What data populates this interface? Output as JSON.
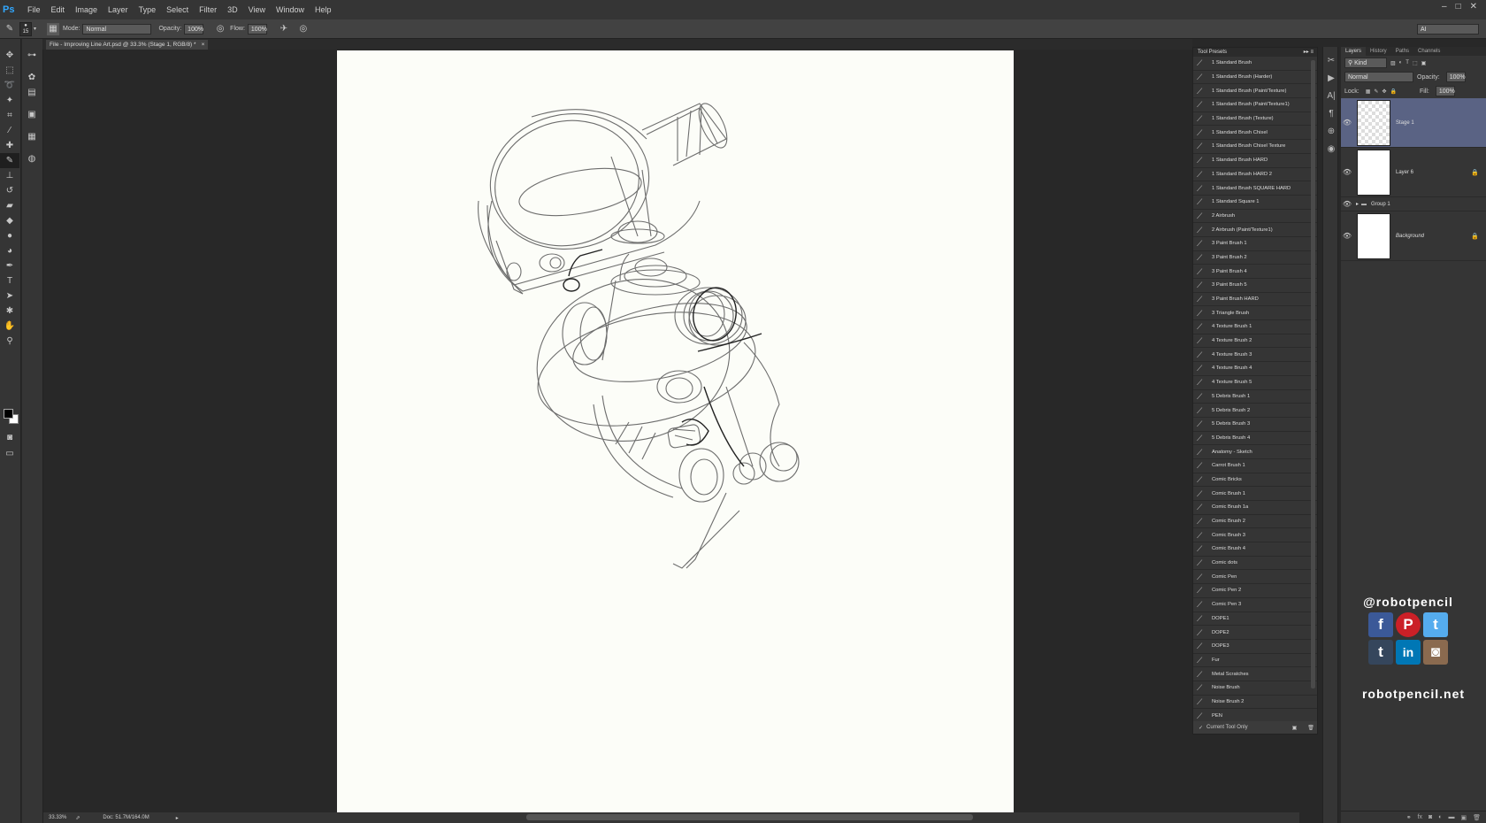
{
  "app": {
    "logo": "Ps",
    "menu": [
      "File",
      "Edit",
      "Image",
      "Layer",
      "Type",
      "Select",
      "Filter",
      "3D",
      "View",
      "Window",
      "Help"
    ],
    "window_controls": [
      "–",
      "□",
      "✕"
    ]
  },
  "options_bar": {
    "brush_size": "15",
    "mode_label": "Mode:",
    "mode_value": "Normal",
    "opacity_label": "Opacity:",
    "opacity_value": "100%",
    "flow_label": "Flow:",
    "flow_value": "100%",
    "workspace_value": "AI"
  },
  "document": {
    "tab_title": "File - Improving Line Art.psd @ 33.3% (Stage 1, RGB/8) *",
    "tab_close": "×"
  },
  "status": {
    "zoom": "33.33%",
    "doc_size": "Doc: 51.7M/164.0M"
  },
  "tool_presets": {
    "title": "Tool Presets",
    "items": [
      "1 Standard Brush",
      "1 Standard Brush (Harder)",
      "1 Standard Brush (Paint/Texture)",
      "1 Standard Brush (Paint/Texture1)",
      "1 Standard Brush (Texture)",
      "1 Standard Brush Chisel",
      "1 Standard Brush Chisel Texture",
      "1 Standard Brush HARD",
      "1 Standard Brush HARD 2",
      "1 Standard Brush SQUARE HARD",
      "1 Standard Square 1",
      "2 Airbrush",
      "2 Airbrush (Paint/Texture1)",
      "3 Paint Brush 1",
      "3 Paint Brush 2",
      "3 Paint Brush 4",
      "3 Paint Brush 5",
      "3 Paint Brush HARD",
      "3 Triangle Brush",
      "4 Texture Brush 1",
      "4 Texture Brush 2",
      "4 Texture Brush 3",
      "4 Texture Brush 4",
      "4 Texture Brush 5",
      "5 Debris Brush 1",
      "5 Debris Brush 2",
      "5 Debris Brush 3",
      "5 Debris Brush 4",
      "Anatomy - Sketch",
      "Carrot Brush 1",
      "Comic Bricks",
      "Comic Brush 1",
      "Comic Brush 1a",
      "Comic Brush 2",
      "Comic Brush 3",
      "Comic Brush 4",
      "Comic dots",
      "Comic Pen",
      "Comic Pen 2",
      "Comic Pen 3",
      "DOPE1",
      "DOPE2",
      "DOPE3",
      "Fur",
      "Metal Scratches",
      "Noise Brush",
      "Noise Brush 2",
      "PEN"
    ],
    "footer_label": "Current Tool Only"
  },
  "layers_panel": {
    "tabs": [
      "Layers",
      "History",
      "Paths",
      "Channels"
    ],
    "kind_label": "Kind",
    "blend_mode": "Normal",
    "opacity_label": "Opacity:",
    "opacity_value": "100%",
    "lock_label": "Lock:",
    "fill_label": "Fill:",
    "fill_value": "100%",
    "layers": [
      {
        "name": "Stage 1",
        "selected": true,
        "locked": false
      },
      {
        "name": "Layer 6",
        "selected": false,
        "locked": true
      }
    ],
    "group_name": "Group 1",
    "background_layer": "Background"
  },
  "branding": {
    "handle": "@robotpencil",
    "site": "robotpencil.net",
    "social_icons": [
      {
        "name": "facebook-icon",
        "glyph": "f",
        "color": "#3b5998"
      },
      {
        "name": "pinterest-icon",
        "glyph": "P",
        "color": "#cb2027"
      },
      {
        "name": "twitter-icon",
        "glyph": "t",
        "color": "#55acee"
      },
      {
        "name": "tumblr-icon",
        "glyph": "t",
        "color": "#35465c"
      },
      {
        "name": "linkedin-icon",
        "glyph": "in",
        "color": "#0077b5"
      },
      {
        "name": "instagram-icon",
        "glyph": "◙",
        "color": "#8a6a4f"
      }
    ]
  }
}
